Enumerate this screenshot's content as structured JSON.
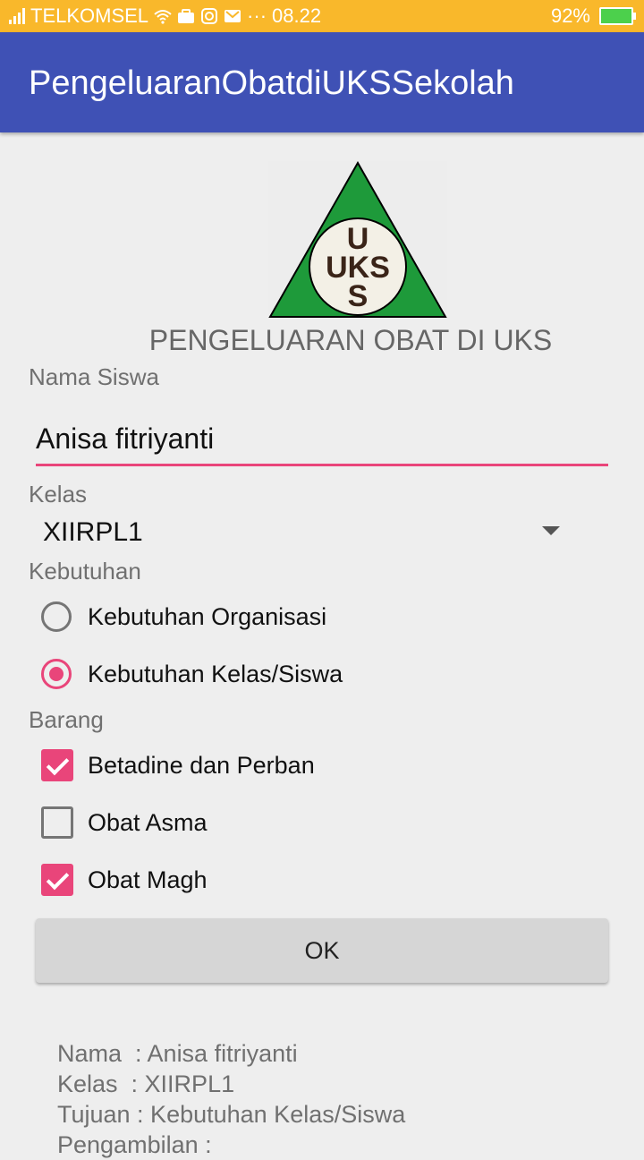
{
  "status_bar": {
    "carrier": "TELKOMSEL",
    "time": "08.22",
    "dots": "···",
    "battery": "92%",
    "icons": [
      "signal-icon",
      "wifi-icon",
      "briefcase-icon",
      "instagram-icon",
      "gmail-icon",
      "battery-charging-icon"
    ]
  },
  "app_bar": {
    "title": "PengeluaranObatdiUKSSekolah"
  },
  "logo": {
    "letter_top": "U",
    "letter_mid": "UKS",
    "letter_bottom": "S",
    "colors": {
      "triangle": "#1e9a3a",
      "circle": "#f3f0e6",
      "text": "#3a2418"
    }
  },
  "heading": "PENGELUARAN OBAT DI UKS",
  "form": {
    "nama_label": "Nama Siswa",
    "nama_value": "Anisa fitriyanti",
    "kelas_label": "Kelas",
    "kelas_value": "XIIRPL1",
    "kebutuhan_label": "Kebutuhan",
    "kebutuhan_options": [
      {
        "label": "Kebutuhan Organisasi",
        "selected": false
      },
      {
        "label": "Kebutuhan Kelas/Siswa",
        "selected": true
      }
    ],
    "barang_label": "Barang",
    "barang_options": [
      {
        "label": "Betadine dan Perban",
        "checked": true
      },
      {
        "label": "Obat Asma",
        "checked": false
      },
      {
        "label": "Obat Magh",
        "checked": true
      }
    ],
    "ok_label": "OK"
  },
  "result": {
    "line1": "Nama  : Anisa fitriyanti",
    "line2": "Kelas  : XIIRPL1",
    "line3": "Tujuan : Kebutuhan Kelas/Siswa",
    "line4": "Pengambilan :"
  },
  "colors": {
    "status_bar": "#f9b82b",
    "app_bar": "#3f51b5",
    "accent": "#e9457a",
    "background": "#eeeeee"
  }
}
